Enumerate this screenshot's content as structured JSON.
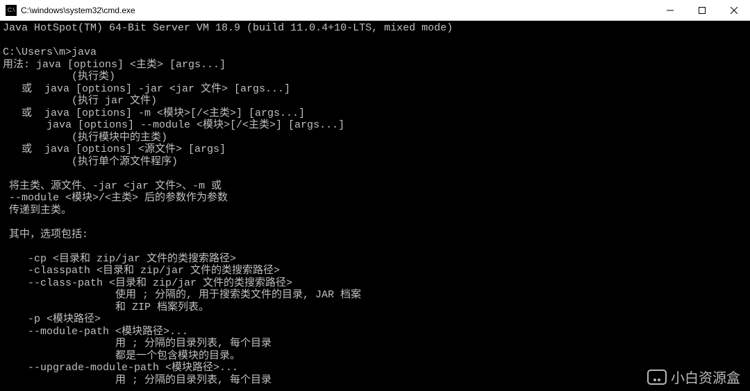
{
  "titlebar": {
    "icon_label": "cmd-icon",
    "icon_text": "C:\\",
    "title": "C:\\windows\\system32\\cmd.exe"
  },
  "terminal": {
    "lines": [
      "Java HotSpot(TM) 64-Bit Server VM 18.9 (build 11.0.4+10-LTS, mixed mode)",
      "",
      "C:\\Users\\m>java",
      "用法: java [options] <主类> [args...]",
      "           (执行类)",
      "   或  java [options] -jar <jar 文件> [args...]",
      "           (执行 jar 文件)",
      "   或  java [options] -m <模块>[/<主类>] [args...]",
      "       java [options] --module <模块>[/<主类>] [args...]",
      "           (执行模块中的主类)",
      "   或  java [options] <源文件> [args]",
      "           (执行单个源文件程序)",
      "",
      " 将主类、源文件、-jar <jar 文件>、-m 或",
      " --module <模块>/<主类> 后的参数作为参数",
      " 传递到主类。",
      "",
      " 其中，选项包括:",
      "",
      "    -cp <目录和 zip/jar 文件的类搜索路径>",
      "    -classpath <目录和 zip/jar 文件的类搜索路径>",
      "    --class-path <目录和 zip/jar 文件的类搜索路径>",
      "                  使用 ; 分隔的, 用于搜索类文件的目录, JAR 档案",
      "                  和 ZIP 档案列表。",
      "    -p <模块路径>",
      "    --module-path <模块路径>...",
      "                  用 ; 分隔的目录列表, 每个目录",
      "                  都是一个包含模块的目录。",
      "    --upgrade-module-path <模块路径>...",
      "                  用 ; 分隔的目录列表, 每个目录"
    ]
  },
  "watermark": {
    "text": "小白资源盒"
  }
}
